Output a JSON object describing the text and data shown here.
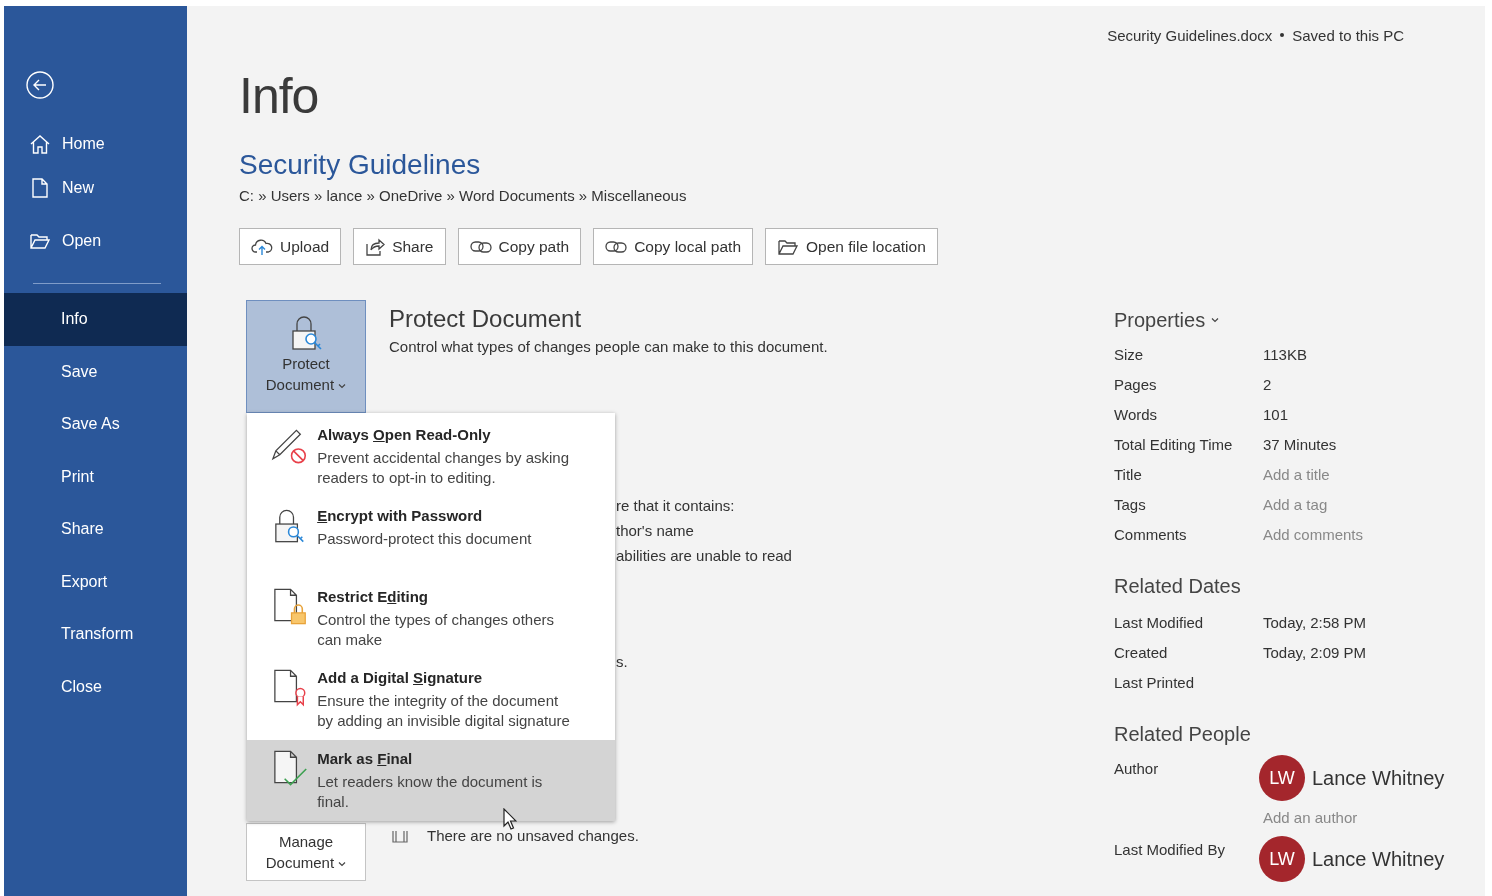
{
  "doc_status": {
    "file_name": "Security Guidelines.docx",
    "save_status": "Saved to this PC"
  },
  "nav_top": [
    {
      "label": "Home"
    },
    {
      "label": "New"
    },
    {
      "label": "Open"
    }
  ],
  "nav_items": [
    {
      "label": "Info",
      "selected": true
    },
    {
      "label": "Save",
      "selected": false
    },
    {
      "label": "Save As",
      "selected": false
    },
    {
      "label": "Print",
      "selected": false
    },
    {
      "label": "Share",
      "selected": false
    },
    {
      "label": "Export",
      "selected": false
    },
    {
      "label": "Transform",
      "selected": false
    },
    {
      "label": "Close",
      "selected": false
    }
  ],
  "page_title": "Info",
  "document": {
    "name": "Security Guidelines",
    "path": "C: » Users » lance » OneDrive » Word Documents » Miscellaneous"
  },
  "actions": [
    "Upload",
    "Share",
    "Copy path",
    "Copy local path",
    "Open file location"
  ],
  "protect": {
    "button_label": "Protect Document",
    "heading": "Protect Document",
    "description": "Control what types of changes people can make to this document.",
    "menu": [
      {
        "title": {
          "before": "Always ",
          "access_key": "O",
          "after": "pen Read-Only"
        },
        "description_lines": [
          "Prevent accidental changes by asking",
          "readers to opt-in to editing."
        ],
        "selected": false
      },
      {
        "title": {
          "access_key": "E",
          "after": "ncrypt with Password"
        },
        "description_lines": [
          "Password-protect this document"
        ],
        "selected": false
      },
      {
        "title": {
          "before": "Restrict E",
          "access_key": "d",
          "after": "iting"
        },
        "description_lines": [
          "Control the types of changes others",
          "can make"
        ],
        "selected": false
      },
      {
        "title": {
          "before": "Add a Digital ",
          "access_key": "S",
          "after": "ignature"
        },
        "description_lines": [
          "Ensure the integrity of the document",
          "by adding an invisible digital signature"
        ],
        "selected": false
      },
      {
        "title": {
          "before": "Mark as ",
          "access_key": "F",
          "after": "inal"
        },
        "description_lines": [
          "Let readers know the document is",
          "final."
        ],
        "selected": true
      }
    ]
  },
  "inspect_fragments": [
    "re that it contains:",
    "thor's name",
    "abilities are unable to read",
    "s."
  ],
  "manage": {
    "button_label": "Manage Document",
    "status": "There are no unsaved changes."
  },
  "properties": {
    "title": "Properties",
    "rows": [
      {
        "label": "Size",
        "value": "113KB",
        "kind": "value"
      },
      {
        "label": "Pages",
        "value": "2",
        "kind": "value"
      },
      {
        "label": "Words",
        "value": "101",
        "kind": "value"
      },
      {
        "label": "Total Editing Time",
        "value": "37 Minutes",
        "kind": "value"
      },
      {
        "label": "Title",
        "value": "Add a title",
        "kind": "prompt"
      },
      {
        "label": "Tags",
        "value": "Add a tag",
        "kind": "prompt"
      },
      {
        "label": "Comments",
        "value": "Add comments",
        "kind": "prompt"
      }
    ]
  },
  "related_dates": {
    "title": "Related Dates",
    "rows": [
      {
        "label": "Last Modified",
        "value": "Today, 2:58 PM"
      },
      {
        "label": "Created",
        "value": "Today, 2:09 PM"
      },
      {
        "label": "Last Printed"
      }
    ]
  },
  "related_people": {
    "title": "Related People",
    "groups": [
      {
        "label": "Author",
        "people": [
          {
            "initials": "LW",
            "name": "Lance Whitney"
          }
        ],
        "add_prompt": "Add an author"
      },
      {
        "label": "Last Modified By",
        "people": [
          {
            "initials": "LW",
            "name": "Lance Whitney"
          }
        ]
      }
    ]
  }
}
